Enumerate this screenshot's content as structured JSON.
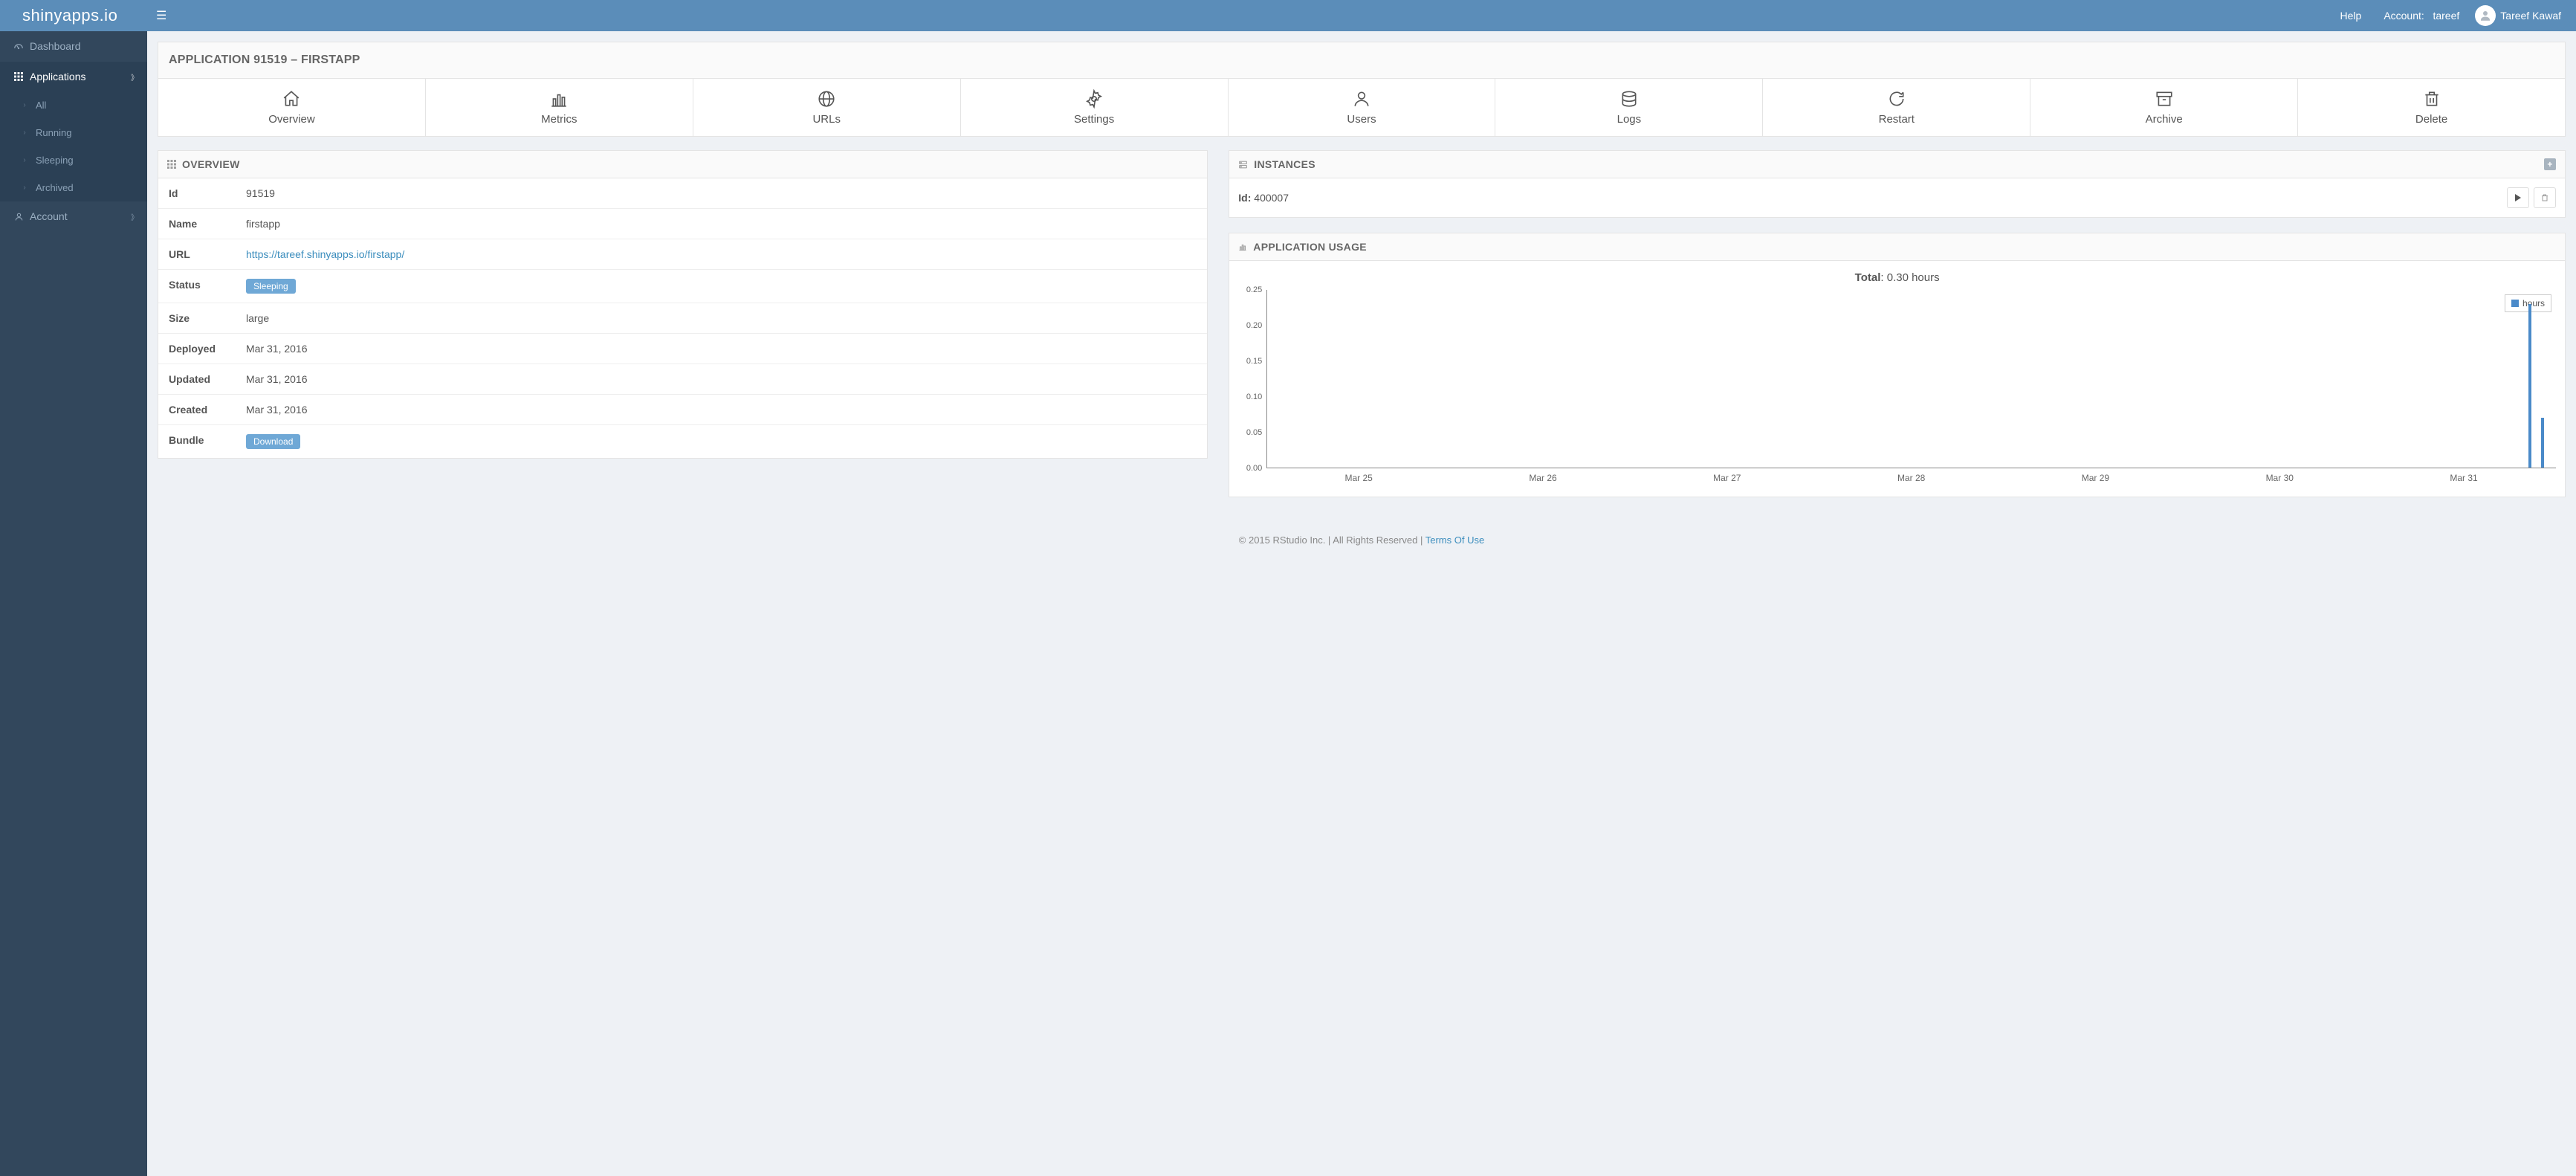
{
  "brand": "shinyapps.io",
  "topbar": {
    "help": "Help",
    "account_label": "Account:",
    "account_name": "tareef",
    "user": "Tareef Kawaf"
  },
  "sidebar": {
    "dashboard": "Dashboard",
    "applications": "Applications",
    "subs": {
      "all": "All",
      "running": "Running",
      "sleeping": "Sleeping",
      "archived": "Archived"
    },
    "account": "Account"
  },
  "page": {
    "title": "APPLICATION 91519 – FIRSTAPP"
  },
  "tabs": {
    "overview": "Overview",
    "metrics": "Metrics",
    "urls": "URLs",
    "settings": "Settings",
    "users": "Users",
    "logs": "Logs",
    "restart": "Restart",
    "archive": "Archive",
    "delete": "Delete"
  },
  "overview": {
    "heading": "OVERVIEW",
    "rows": {
      "id_k": "Id",
      "id_v": "91519",
      "name_k": "Name",
      "name_v": "firstapp",
      "url_k": "URL",
      "url_v": "https://tareef.shinyapps.io/firstapp/",
      "status_k": "Status",
      "status_v": "Sleeping",
      "size_k": "Size",
      "size_v": "large",
      "deployed_k": "Deployed",
      "deployed_v": "Mar 31, 2016",
      "updated_k": "Updated",
      "updated_v": "Mar 31, 2016",
      "created_k": "Created",
      "created_v": "Mar 31, 2016",
      "bundle_k": "Bundle",
      "bundle_btn": "Download"
    }
  },
  "instances": {
    "heading": "INSTANCES",
    "id_label": "Id:",
    "id_value": "400007"
  },
  "usage": {
    "heading": "APPLICATION USAGE",
    "total_label": "Total",
    "total_value": ": 0.30 hours",
    "legend": "hours"
  },
  "footer": {
    "text": "© 2015 RStudio Inc. | All Rights Reserved | ",
    "link": "Terms Of Use"
  },
  "chart_data": {
    "type": "bar",
    "title": "Total: 0.30 hours",
    "ylabel": "hours",
    "ylim": [
      0,
      0.25
    ],
    "yticks": [
      0.0,
      0.05,
      0.1,
      0.15,
      0.2,
      0.25
    ],
    "categories": [
      "Mar 25",
      "Mar 26",
      "Mar 27",
      "Mar 28",
      "Mar 29",
      "Mar 30",
      "Mar 31"
    ],
    "series": [
      {
        "name": "hours",
        "values": [
          0,
          0,
          0,
          0,
          0,
          0,
          0.23
        ]
      },
      {
        "name": "hours",
        "values": [
          0,
          0,
          0,
          0,
          0,
          0,
          0.07
        ]
      }
    ],
    "color": "#4a8ac9"
  }
}
